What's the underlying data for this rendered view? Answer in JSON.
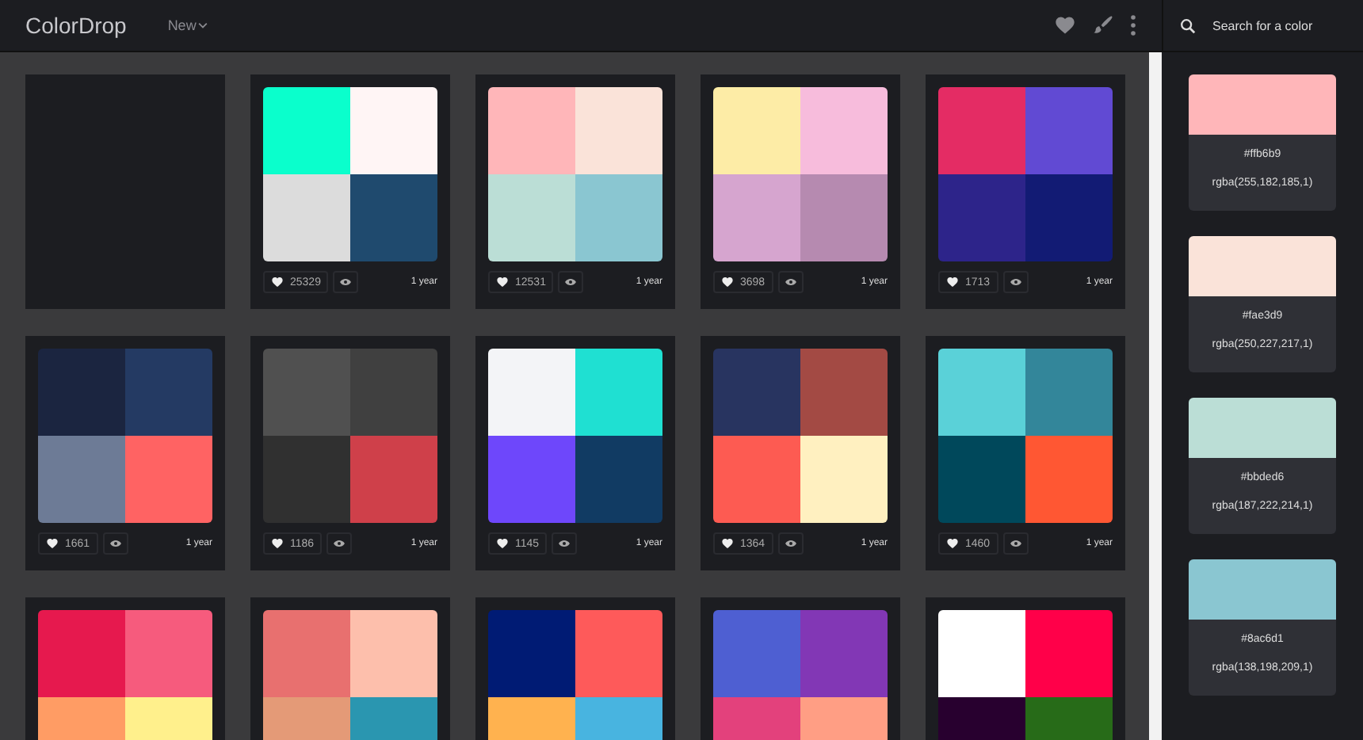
{
  "header": {
    "logo": "ColorDrop",
    "menu": "New",
    "search": {
      "placeholder": "Search for a color"
    }
  },
  "palettes": [
    {
      "kind": "empty"
    },
    {
      "kind": "palette",
      "swatches": [
        {
          "color": "#0affcc"
        },
        {
          "color": "#fff5f5"
        },
        {
          "color": "#dcdcdc"
        },
        {
          "color": "#1f4a6e"
        }
      ],
      "likes": "25329",
      "age": "1 year"
    },
    {
      "kind": "palette",
      "swatches": [
        {
          "color": "#ffb6b9"
        },
        {
          "color": "#fae3d9"
        },
        {
          "color": "#bbded6"
        },
        {
          "color": "#8ac6d1"
        }
      ],
      "likes": "12531",
      "age": "1 year"
    },
    {
      "kind": "palette",
      "swatches": [
        {
          "color": "#fdeca6"
        },
        {
          "color": "#f7bcdc"
        },
        {
          "color": "#d6a5cf"
        },
        {
          "color": "#b68ab0"
        }
      ],
      "likes": "3698",
      "age": "1 year"
    },
    {
      "kind": "palette",
      "swatches": [
        {
          "color": "#e42c64"
        },
        {
          "color": "#614ad3"
        },
        {
          "color": "#2d248a"
        },
        {
          "color": "#121b74"
        }
      ],
      "likes": "1713",
      "age": "1 year"
    },
    {
      "kind": "palette",
      "swatches": [
        {
          "color": "#1b2540"
        },
        {
          "color": "#243a63"
        },
        {
          "color": "#6d7b96"
        },
        {
          "color": "#ff6363"
        }
      ],
      "likes": "1661",
      "age": "1 year"
    },
    {
      "kind": "palette",
      "swatches": [
        {
          "color": "#505050"
        },
        {
          "color": "#404040"
        },
        {
          "color": "#303030"
        },
        {
          "color": "#cf404a"
        }
      ],
      "likes": "1186",
      "age": "1 year"
    },
    {
      "kind": "palette",
      "swatches": [
        {
          "color": "#f3f4f7"
        },
        {
          "color": "#1fe0d2"
        },
        {
          "color": "#6e47fb"
        },
        {
          "color": "#113b63"
        }
      ],
      "likes": "1145",
      "age": "1 year"
    },
    {
      "kind": "palette",
      "swatches": [
        {
          "color": "#283460"
        },
        {
          "color": "#a34a44"
        },
        {
          "color": "#fd5b52"
        },
        {
          "color": "#fff0c0"
        }
      ],
      "likes": "1364",
      "age": "1 year"
    },
    {
      "kind": "palette",
      "swatches": [
        {
          "color": "#5ad1d8"
        },
        {
          "color": "#33869a"
        },
        {
          "color": "#00485b"
        },
        {
          "color": "#ff5733"
        }
      ],
      "likes": "1460",
      "age": "1 year"
    },
    {
      "kind": "palette",
      "swatches": [
        {
          "color": "#e6194e"
        },
        {
          "color": "#f65b7d"
        },
        {
          "color": "#ff9c64"
        },
        {
          "color": "#fff08c"
        }
      ]
    },
    {
      "kind": "palette",
      "swatches": [
        {
          "color": "#e8706f"
        },
        {
          "color": "#fdbfac"
        },
        {
          "color": "#e49a77"
        },
        {
          "color": "#2a96b0"
        }
      ]
    },
    {
      "kind": "palette",
      "swatches": [
        {
          "color": "#001b74"
        },
        {
          "color": "#fe5a5a"
        },
        {
          "color": "#ffb24f"
        },
        {
          "color": "#48b4e0"
        }
      ]
    },
    {
      "kind": "palette",
      "swatches": [
        {
          "color": "#4e5fd2"
        },
        {
          "color": "#8237b5"
        },
        {
          "color": "#e3417c"
        },
        {
          "color": "#ff9e84"
        }
      ]
    },
    {
      "kind": "palette",
      "swatches": [
        {
          "color": "#ffffff"
        },
        {
          "color": "#ff0049"
        },
        {
          "color": "#28002f"
        },
        {
          "color": "#276b18"
        }
      ]
    }
  ],
  "sidebar_colors": [
    {
      "color": "#ffb6b9",
      "hex": "#ffb6b9",
      "rgba": "rgba(255,182,185,1)"
    },
    {
      "color": "#fae3d9",
      "hex": "#fae3d9",
      "rgba": "rgba(250,227,217,1)"
    },
    {
      "color": "#bbded6",
      "hex": "#bbded6",
      "rgba": "rgba(187,222,214,1)"
    },
    {
      "color": "#8ac6d1",
      "hex": "#8ac6d1",
      "rgba": "rgba(138,198,209,1)"
    }
  ]
}
